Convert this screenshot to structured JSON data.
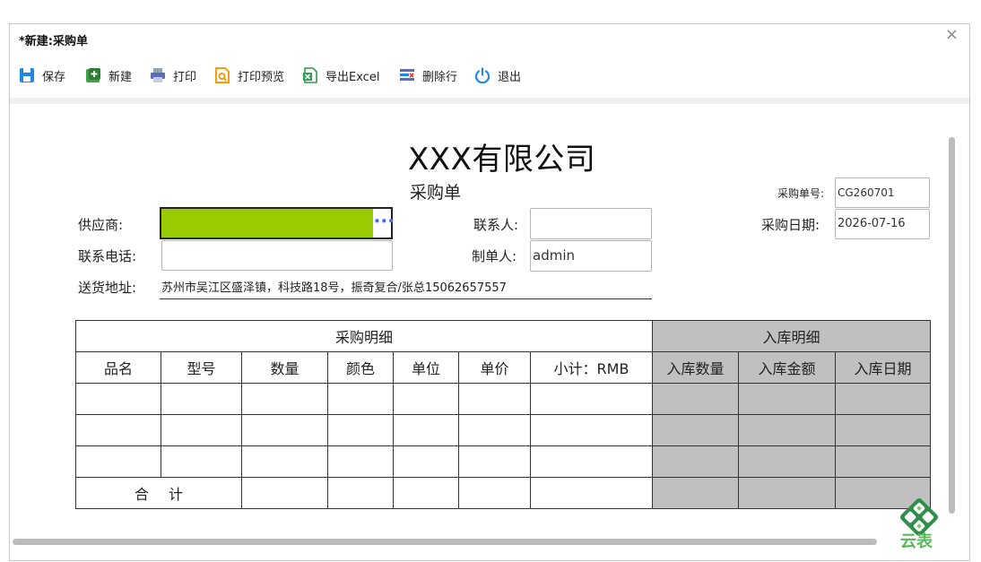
{
  "window": {
    "title": "*新建:采购单",
    "close_glyph": "×"
  },
  "toolbar": {
    "save": "保存",
    "new": "新建",
    "print": "打印",
    "print_preview": "打印预览",
    "export_excel": "导出Excel",
    "delete_row": "删除行",
    "exit": "退出"
  },
  "form": {
    "company": "XXX有限公司",
    "subtitle": "采购单",
    "order_no_label": "采购单号:",
    "order_no_value": "CG260701",
    "order_date_label": "采购日期:",
    "order_date_value": "2026-07-16",
    "supplier_label": "供应商:",
    "supplier_value": "",
    "supplier_button": "•••",
    "contact_label": "联系人:",
    "contact_value": "",
    "phone_label": "联系电话:",
    "phone_value": "",
    "creator_label": "制单人:",
    "creator_value": "admin",
    "address_label": "送货地址:",
    "address_value": "苏州市吴江区盛泽镇，科技路18号，振奇复合/张总15062657557"
  },
  "table": {
    "purchase_section": "采购明细",
    "stock_section": "入库明细",
    "columns": [
      "品名",
      "型号",
      "数量",
      "颜色",
      "单位",
      "单价",
      "小计：RMB",
      "入库数量",
      "入库金额",
      "入库日期"
    ],
    "total_label": "合计"
  },
  "logo": {
    "text": "云表"
  },
  "colors": {
    "supplier_fill": "#99cc00",
    "stock_section_fill": "#c0c0c0",
    "logo_green": "#5cb85c"
  }
}
